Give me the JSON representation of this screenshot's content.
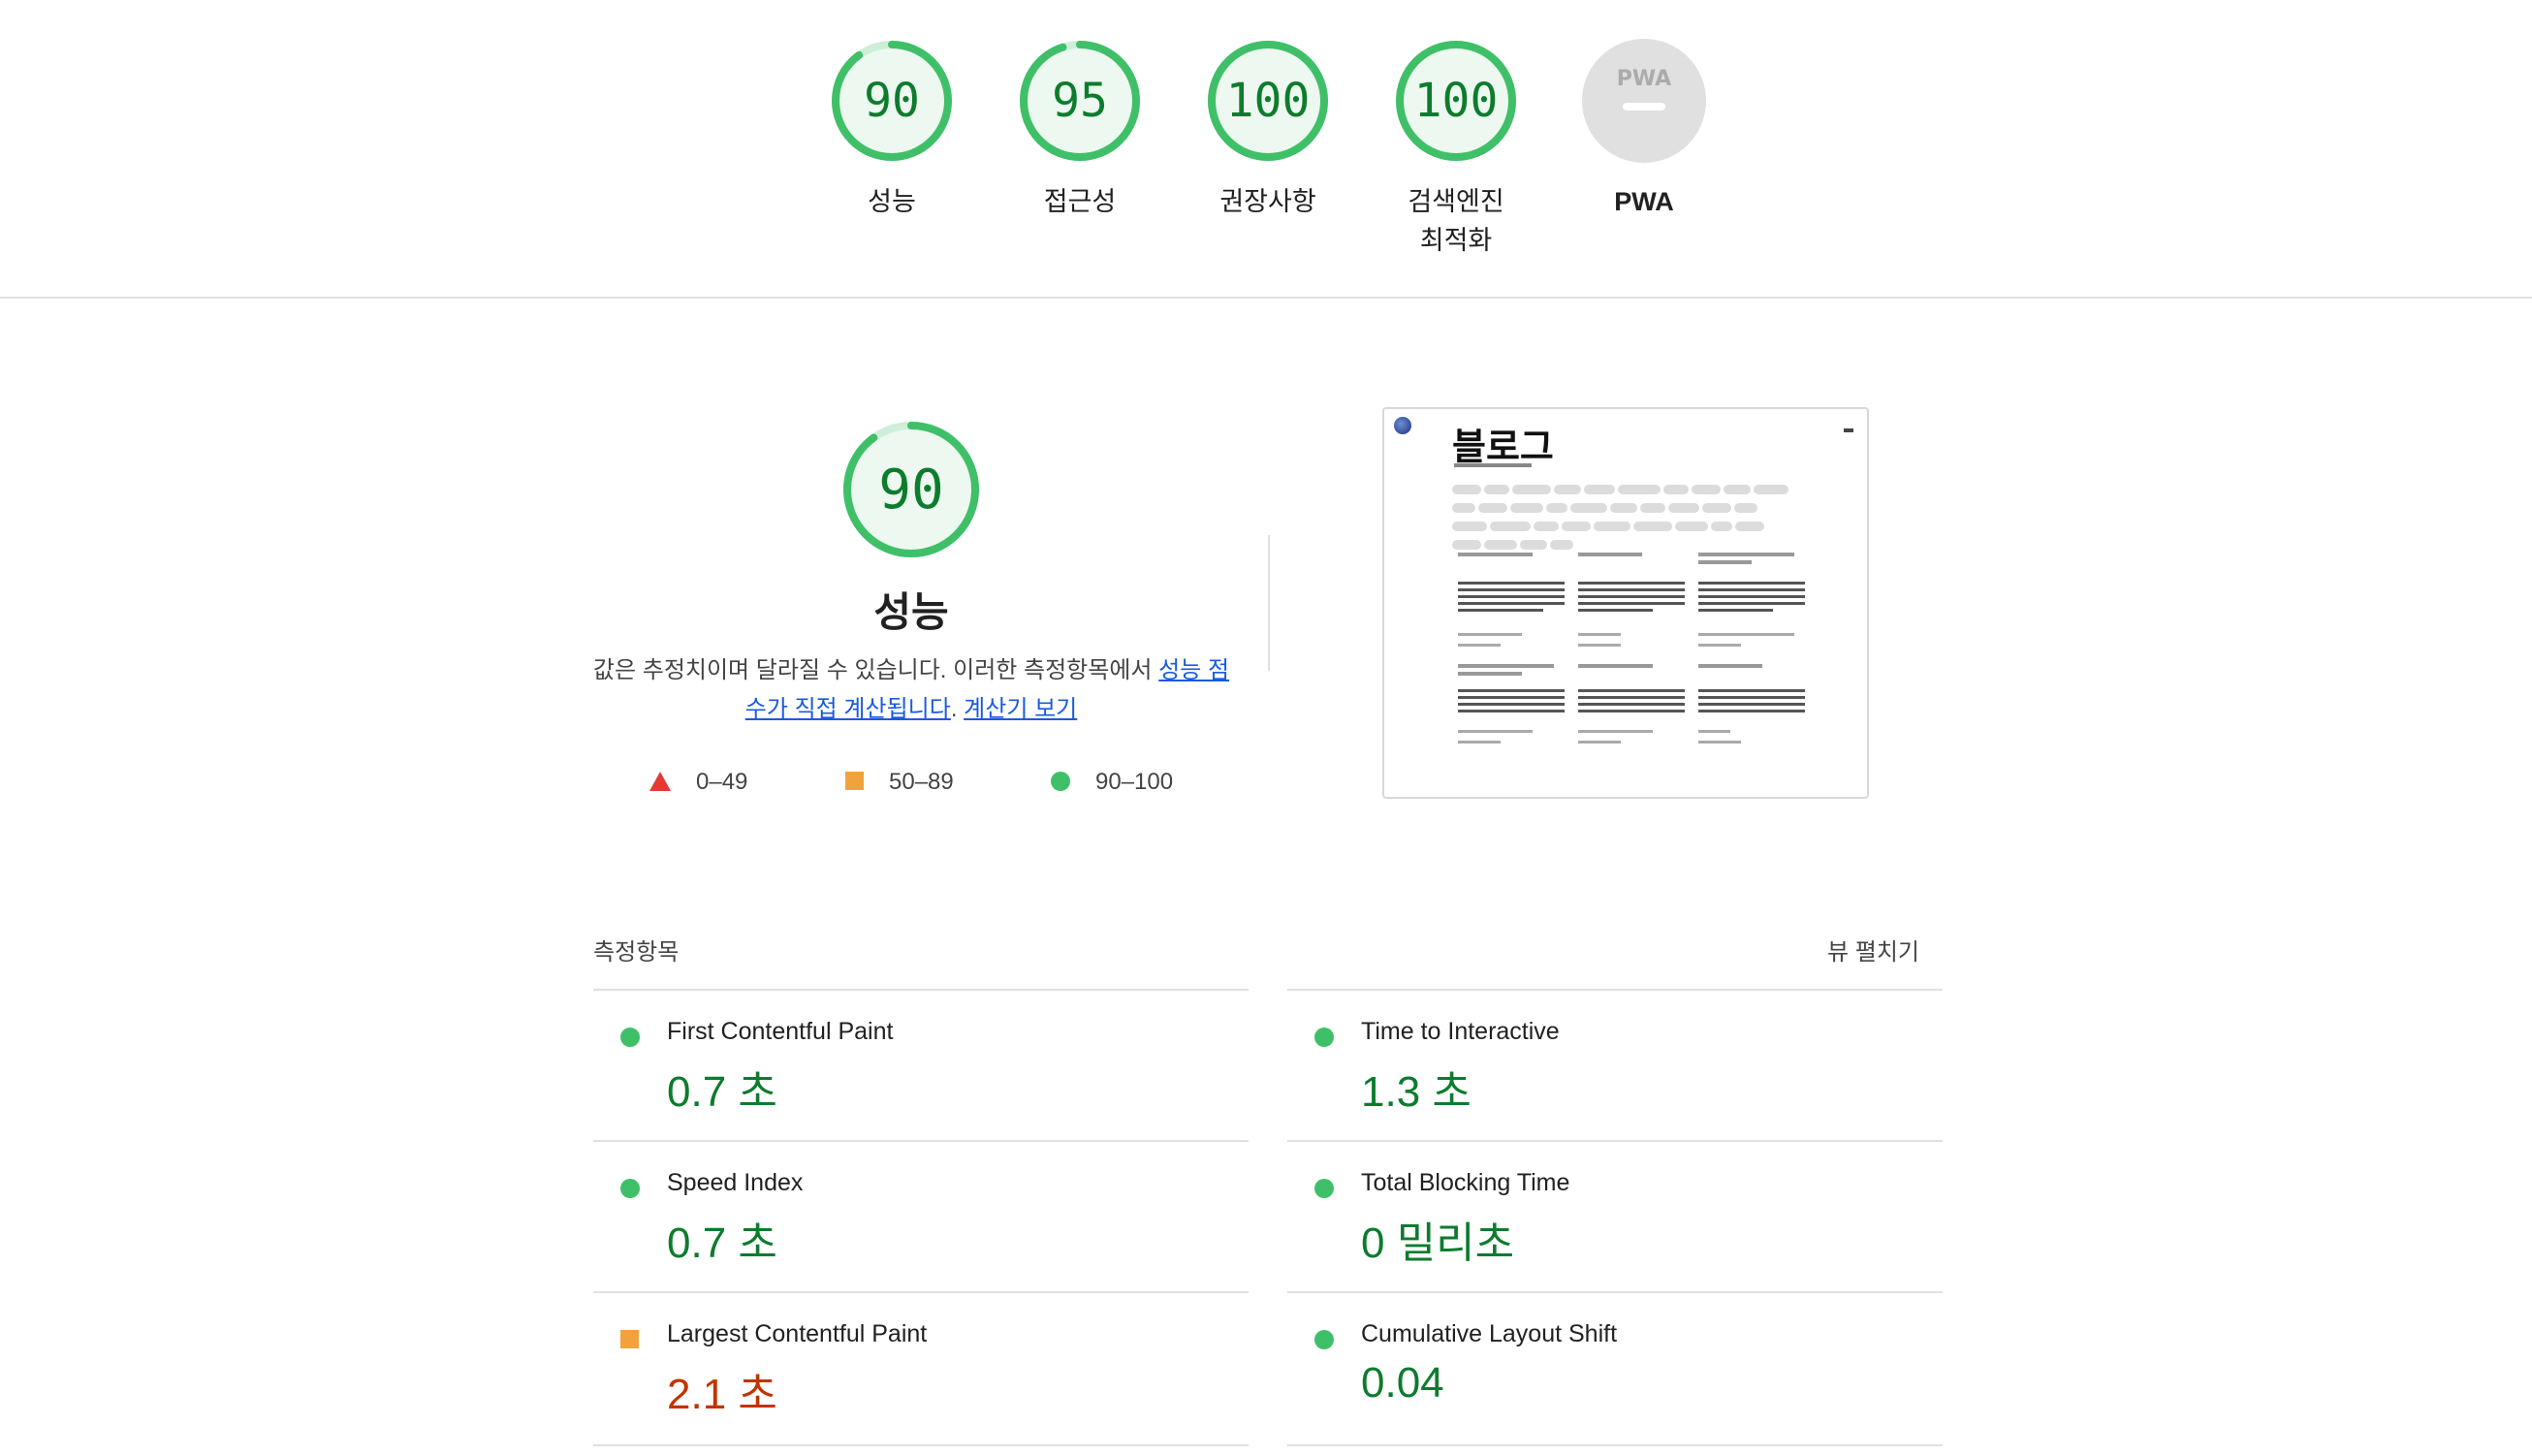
{
  "categories": [
    {
      "score": "90",
      "label": "성능",
      "value": 0.9
    },
    {
      "score": "95",
      "label": "접근성",
      "value": 0.95
    },
    {
      "score": "100",
      "label": "권장사항",
      "value": 1.0
    },
    {
      "score": "100",
      "label": "검색엔진\n최적화",
      "label_line1": "검색엔진",
      "label_line2": "최적화",
      "value": 1.0
    },
    {
      "score": "",
      "label": "PWA",
      "logo": "PWA"
    }
  ],
  "performance": {
    "score": "90",
    "value": 0.9,
    "title": "성능",
    "desc_prefix": "값은 추정치이며 달라질 수 있습니다. 이러한 측정항목에서 ",
    "link1": "성능 점수가 직접 계산됩니다",
    "desc_mid": ". ",
    "link2": "계산기 보기"
  },
  "legend": [
    {
      "icon": "triangle-icon",
      "label": "0–49",
      "color": "#e53935"
    },
    {
      "icon": "square-icon",
      "label": "50–89",
      "color": "#f2a23c"
    },
    {
      "icon": "circle-icon",
      "label": "90–100",
      "color": "#3fc068"
    }
  ],
  "thumbnail": {
    "title": "블로그"
  },
  "metrics": {
    "title": "측정항목",
    "toggle": "뷰 펼치기",
    "items": [
      {
        "name": "First Contentful Paint",
        "value": "0.7 초",
        "status": "good"
      },
      {
        "name": "Time to Interactive",
        "value": "1.3 초",
        "status": "good"
      },
      {
        "name": "Speed Index",
        "value": "0.7 초",
        "status": "good"
      },
      {
        "name": "Total Blocking Time",
        "value": "0 밀리초",
        "status": "good"
      },
      {
        "name": "Largest Contentful Paint",
        "value": "2.1 초",
        "status": "average"
      },
      {
        "name": "Cumulative Layout Shift",
        "value": "0.04",
        "status": "good"
      }
    ]
  },
  "colors": {
    "good": "#0c7c2d",
    "good_ring": "#3fc068",
    "average": "#f2a23c",
    "poor": "#e53935"
  }
}
